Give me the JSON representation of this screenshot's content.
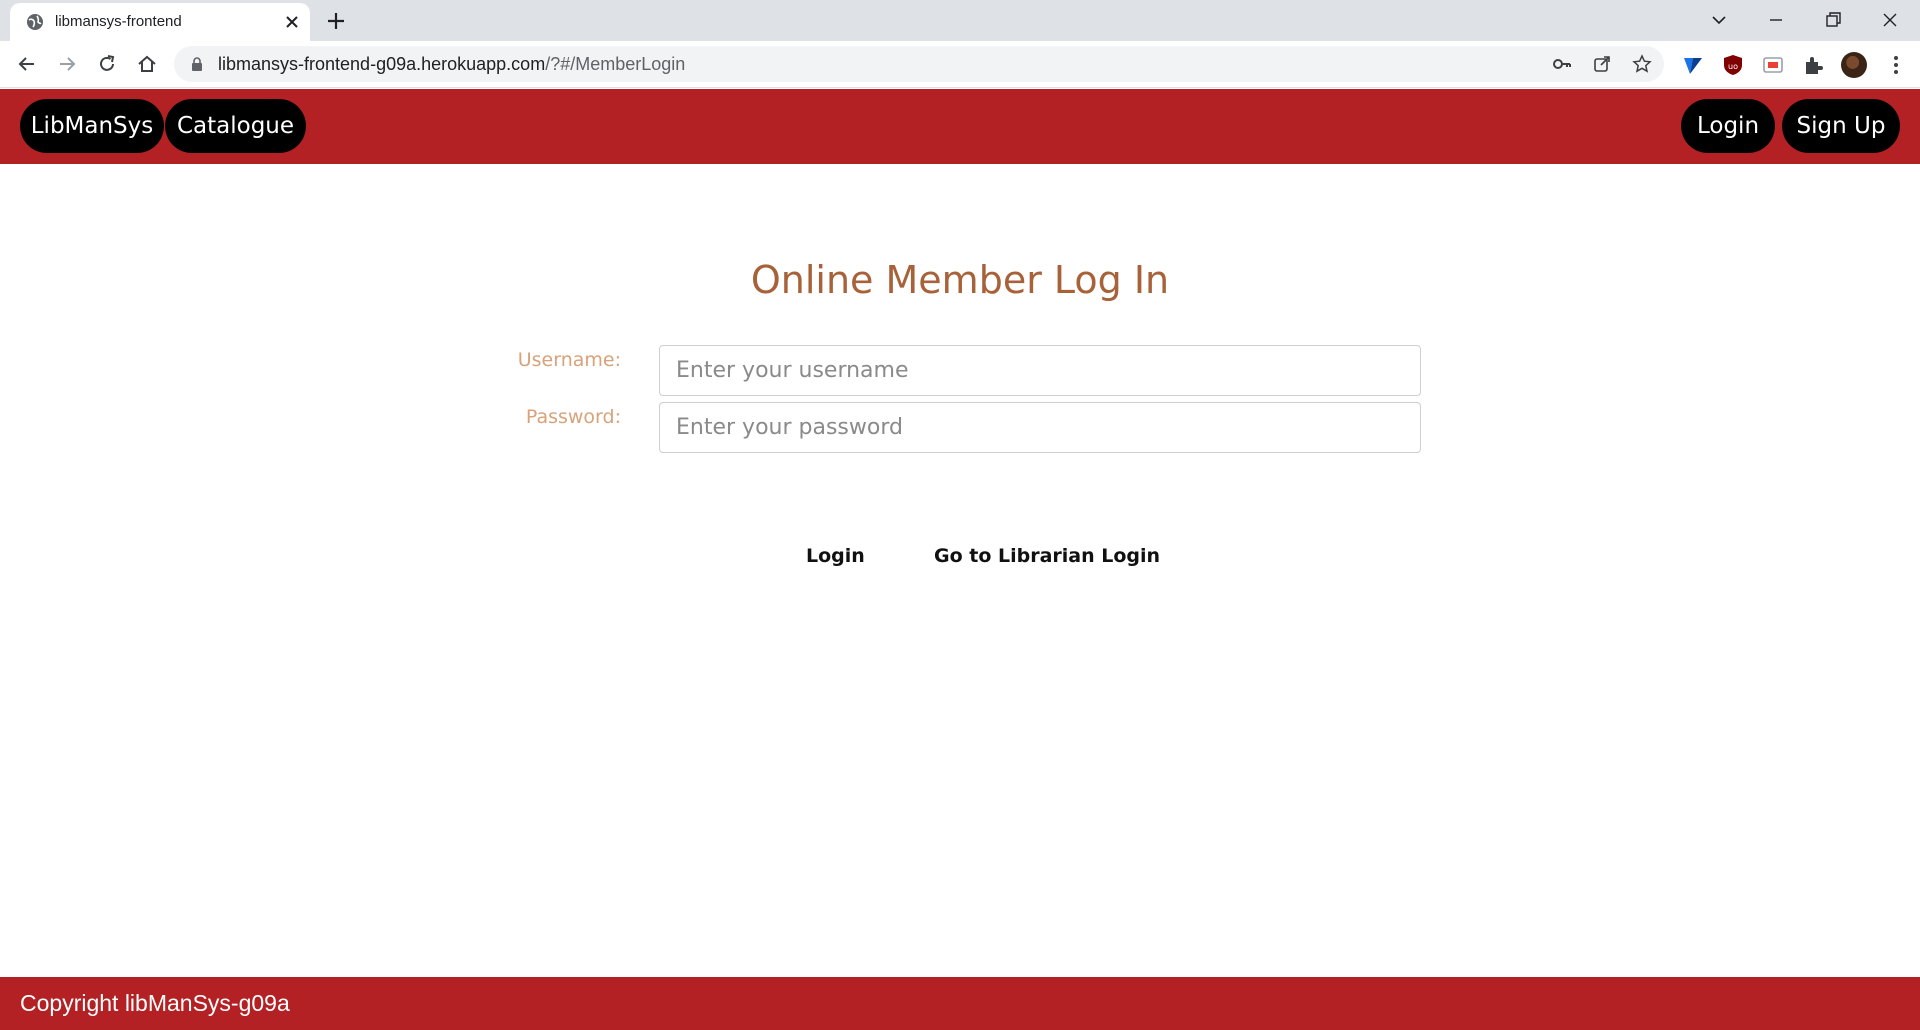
{
  "browser": {
    "tab_title": "libmansys-frontend",
    "url_domain": "libmansys-frontend-g09a.herokuapp.com",
    "url_path": "/?#/MemberLogin",
    "icons": [
      "globe-icon",
      "close-icon",
      "plus-icon",
      "chevron-down-icon",
      "minimize-icon",
      "restore-icon",
      "back-icon",
      "forward-icon",
      "reload-icon",
      "home-icon",
      "lock-icon",
      "key-icon",
      "share-icon",
      "star-icon",
      "extension-icon",
      "menu-icon"
    ]
  },
  "nav": {
    "brand": "LibManSys",
    "catalogue": "Catalogue",
    "login": "Login",
    "signup": "Sign Up"
  },
  "form": {
    "title": "Online Member Log In",
    "username_label": "Username:",
    "username_placeholder": "Enter your username",
    "password_label": "Password:",
    "password_placeholder": "Enter your password",
    "login_button": "Login",
    "librarian_link": "Go to Librarian Login"
  },
  "footer": {
    "text": "Copyright libManSys-g09a"
  },
  "colors": {
    "brand_red": "#b32124",
    "pill_black": "#000000",
    "title_brown": "#a8623a",
    "label_tan": "#d8a27a"
  }
}
